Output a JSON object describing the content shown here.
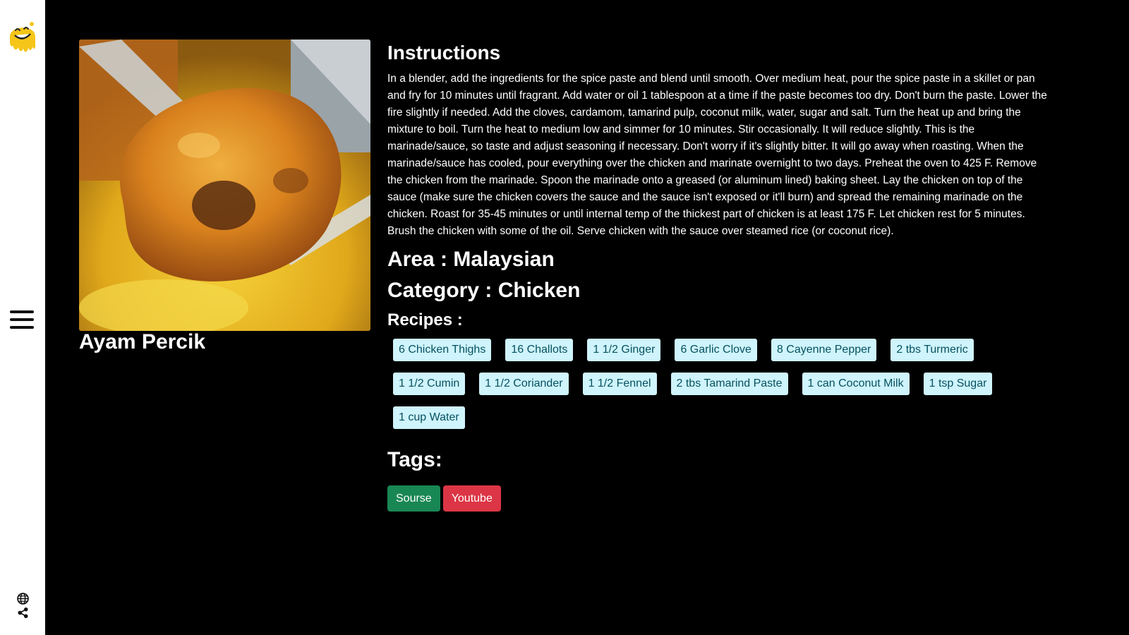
{
  "meal": {
    "name": "Ayam Percik",
    "image_alt": "Ayam Percik"
  },
  "instructions": {
    "title": "Instructions",
    "text": "In a blender, add the ingredients for the spice paste and blend until smooth. Over medium heat, pour the spice paste in a skillet or pan and fry for 10 minutes until fragrant. Add water or oil 1 tablespoon at a time if the paste becomes too dry. Don't burn the paste. Lower the fire slightly if needed. Add the cloves, cardamom, tamarind pulp, coconut milk, water, sugar and salt. Turn the heat up and bring the mixture to boil. Turn the heat to medium low and simmer for 10 minutes. Stir occasionally. It will reduce slightly. This is the marinade/sauce, so taste and adjust seasoning if necessary. Don't worry if it's slightly bitter. It will go away when roasting. When the marinade/sauce has cooled, pour everything over the chicken and marinate overnight to two days. Preheat the oven to 425 F. Remove the chicken from the marinade. Spoon the marinade onto a greased (or aluminum lined) baking sheet. Lay the chicken on top of the sauce (make sure the chicken covers the sauce and the sauce isn't exposed or it'll burn) and spread the remaining marinade on the chicken. Roast for 35-45 minutes or until internal temp of the thickest part of chicken is at least 175 F. Let chicken rest for 5 minutes. Brush the chicken with some of the oil. Serve chicken with the sauce over steamed rice (or coconut rice)."
  },
  "area_line": "Area : Malaysian",
  "category_line": "Category : Chicken",
  "recipes_title": "Recipes :",
  "ingredients": [
    "6 Chicken Thighs",
    "16 Challots",
    "1 1/2 Ginger",
    "6 Garlic Clove",
    "8 Cayenne Pepper",
    "2 tbs Turmeric",
    "1 1/2 Cumin",
    "1 1/2 Coriander",
    "1 1/2 Fennel",
    "2 tbs Tamarind Paste",
    "1 can Coconut Milk",
    "1 tsp Sugar",
    "1 cup Water"
  ],
  "tags_title": "Tags:",
  "buttons": {
    "source": "Sourse",
    "youtube": "Youtube"
  },
  "sidebar": {
    "logo_icon": "smiley-logo-icon",
    "menu_icon": "hamburger-menu-icon",
    "globe_icon": "globe-icon",
    "share_icon": "share-icon"
  },
  "colors": {
    "chip_bg": "#cff4fc",
    "chip_text": "#055160",
    "source_btn": "#198754",
    "youtube_btn": "#dc3545",
    "logo": "#f5c518"
  }
}
